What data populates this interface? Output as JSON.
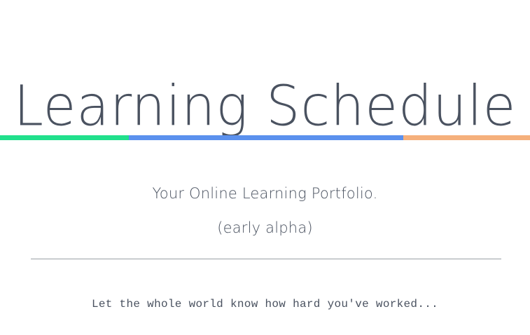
{
  "header": {
    "title": "Learning Schedule"
  },
  "hero": {
    "subtitle": "Your Online Learning Portfolio.",
    "note": "(early alpha)",
    "tagline": "Let the whole world know how hard you've worked..."
  },
  "colors": {
    "text": "#4a5260",
    "bar_green": "#21e08c",
    "bar_blue": "#5b91ee",
    "bar_orange": "#f5b07c",
    "divider": "#9aa0a6"
  }
}
